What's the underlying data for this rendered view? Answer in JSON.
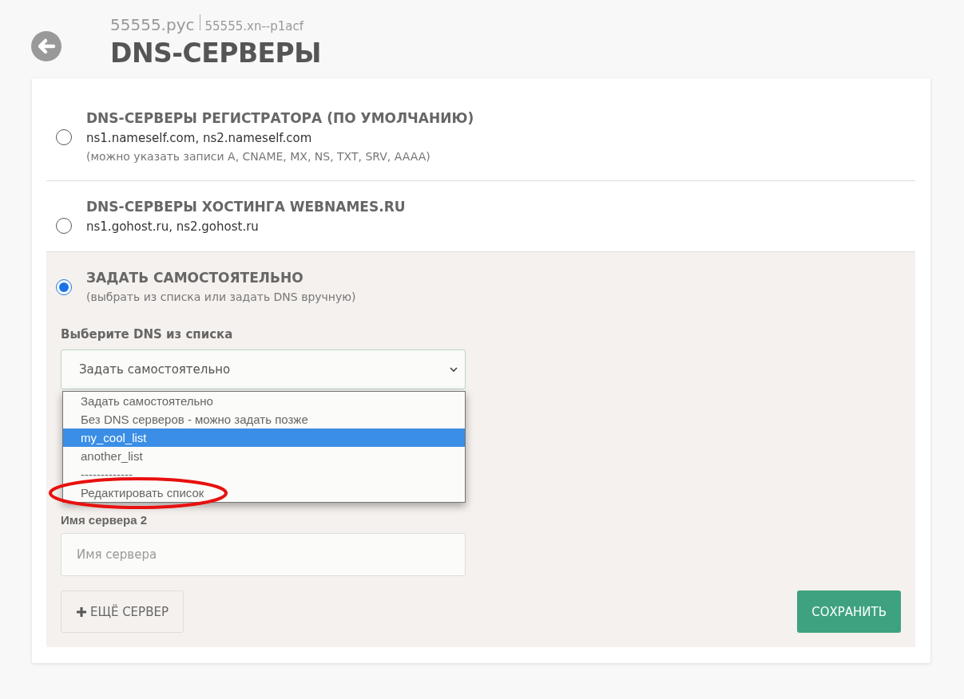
{
  "header": {
    "domain": "55555.рус",
    "domain_puny": "55555.xn--p1acf",
    "title": "DNS-СЕРВЕРЫ"
  },
  "options": [
    {
      "kind": "plain",
      "selected": false,
      "title": "DNS-СЕРВЕРЫ РЕГИСТРАТОРА (ПО УМОЛЧАНИЮ)",
      "servers": "ns1.nameself.com, ns2.nameself.com",
      "note": "(можно указать записи A, CNAME, MX, NS, TXT, SRV, AAAA)"
    },
    {
      "kind": "plain",
      "selected": false,
      "title": "DNS-СЕРВЕРЫ ХОСТИНГА WEBNAMES.RU",
      "servers": "ns1.gohost.ru, ns2.gohost.ru"
    },
    {
      "kind": "custom",
      "selected": true,
      "title": "ЗАДАТЬ САМОСТОЯТЕЛЬНО",
      "note": "(выбрать из списка или задать DNS вручную)"
    }
  ],
  "custom": {
    "select_label": "Выберите DNS из списка",
    "select_value": "Задать самостоятельно",
    "dropdown": [
      {
        "label": "Задать самостоятельно",
        "selected": false
      },
      {
        "label": "Без DNS серверов - можно задать позже",
        "selected": false
      },
      {
        "label": "my_cool_list",
        "selected": true
      },
      {
        "label": "another_list",
        "selected": false
      },
      {
        "label": "-------------",
        "selected": false
      },
      {
        "label": "Редактировать список",
        "selected": false
      }
    ],
    "server_label": "Имя сервера 2",
    "server_placeholder": "Имя сервера",
    "add_button": "ЕЩЁ СЕРВЕР",
    "save_button": "СОХРАНИТЬ"
  },
  "annotation": {
    "kind": "circle",
    "color": "#e8100e"
  }
}
